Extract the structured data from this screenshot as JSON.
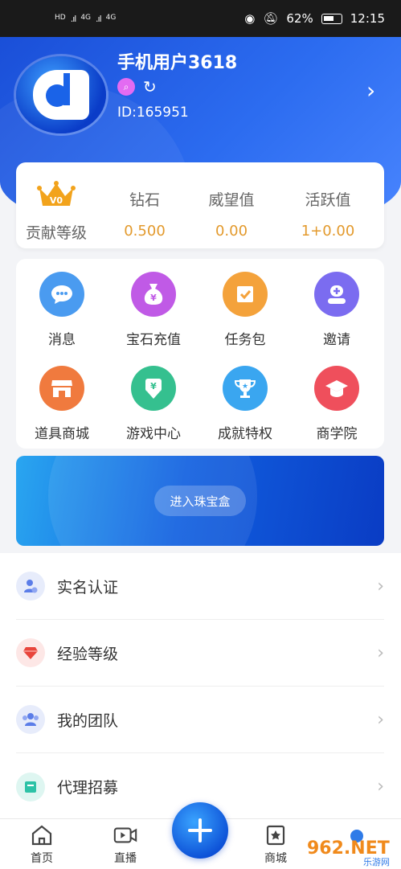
{
  "status_bar": {
    "left": [
      "HD",
      "4G",
      "4G"
    ],
    "battery": "62%",
    "time": "12:15"
  },
  "profile": {
    "name": "手机用户3618",
    "id": "ID:165951"
  },
  "stats": {
    "level_label": "贡献等级",
    "crown_text": "V0",
    "items": [
      {
        "label": "钻石",
        "value": "0.500"
      },
      {
        "label": "威望值",
        "value": "0.00"
      },
      {
        "label": "活跃值",
        "value": "1+0.00"
      }
    ]
  },
  "grid": [
    {
      "label": "消息",
      "icon": "chat-icon",
      "color": "#4a9bf0"
    },
    {
      "label": "宝石充值",
      "icon": "money-bag-icon",
      "color": "#c05ae6"
    },
    {
      "label": "任务包",
      "icon": "task-icon",
      "color": "#f4a23b"
    },
    {
      "label": "邀请",
      "icon": "invite-icon",
      "color": "#7b6cf0"
    },
    {
      "label": "道具商城",
      "icon": "shop-icon",
      "color": "#f07a3e"
    },
    {
      "label": "游戏中心",
      "icon": "game-icon",
      "color": "#35c08f"
    },
    {
      "label": "成就特权",
      "icon": "trophy-icon",
      "color": "#3aa6f0"
    },
    {
      "label": "商学院",
      "icon": "graduation-icon",
      "color": "#ef4f5c"
    }
  ],
  "banner": {
    "button": "进入珠宝盒"
  },
  "list": [
    {
      "label": "实名认证",
      "icon": "verify-icon",
      "color": "#5b7de8",
      "bg": "#e7ecfb"
    },
    {
      "label": "经验等级",
      "icon": "diamond-icon",
      "color": "#e8453c",
      "bg": "#fde7e6"
    },
    {
      "label": "我的团队",
      "icon": "team-icon",
      "color": "#5b7de8",
      "bg": "#e7ecfb"
    },
    {
      "label": "代理招募",
      "icon": "recruit-icon",
      "color": "#2cc2a6",
      "bg": "#def6f1"
    }
  ],
  "nav": [
    {
      "label": "首页",
      "icon": "home-icon"
    },
    {
      "label": "直播",
      "icon": "video-icon"
    },
    {
      "label": "商城",
      "icon": "star-shop-icon"
    }
  ],
  "watermark": {
    "text": "962.NET",
    "sub": "乐游网"
  }
}
